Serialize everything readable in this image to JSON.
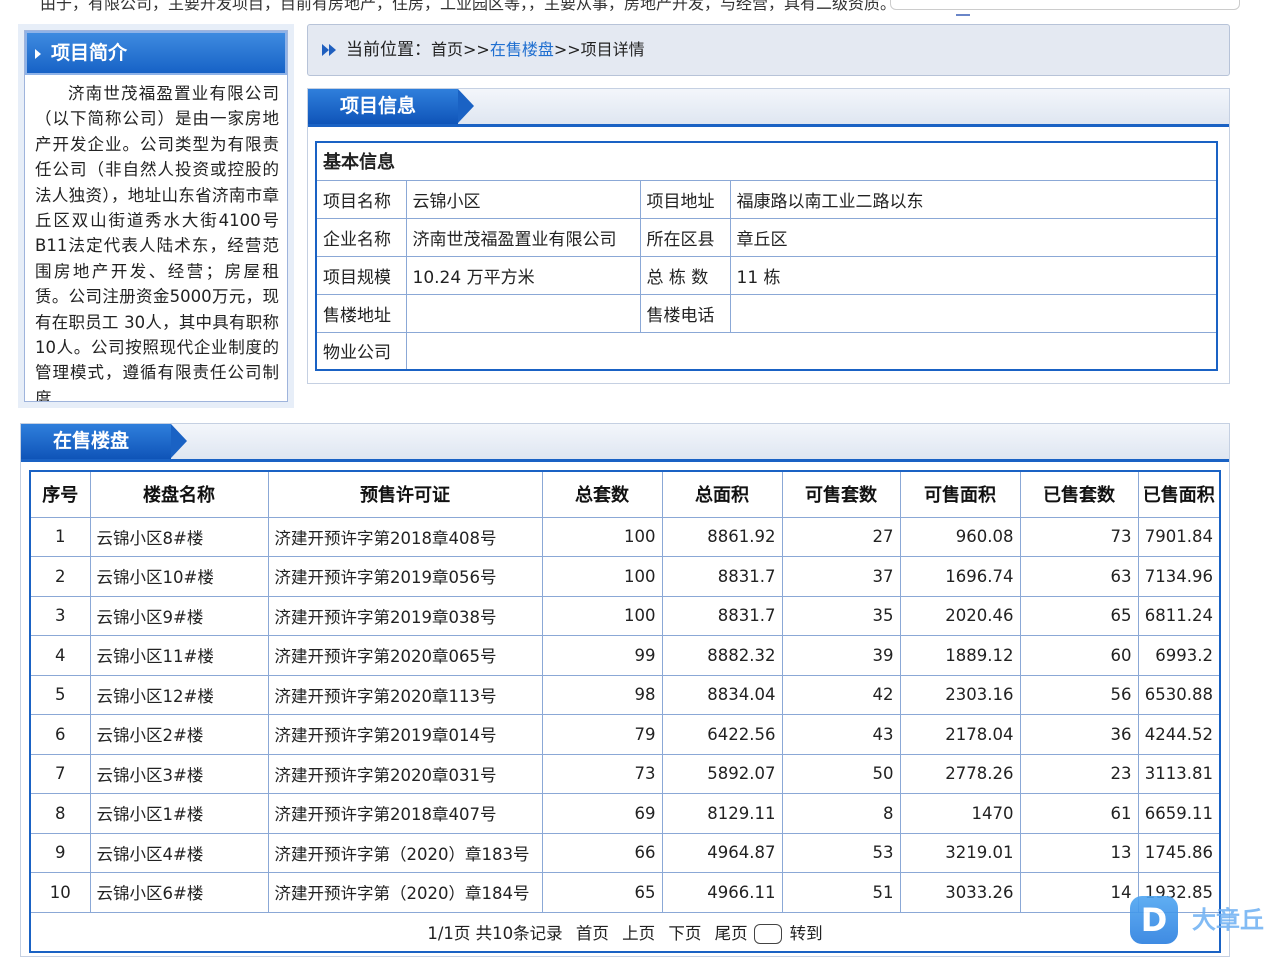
{
  "top": {
    "cut_text": "由于，有限公司，主要开发项目，目前有房地产，住房，工业园区等，，主要从事，房地产开发，与经营，具有二级资质。"
  },
  "sidebar": {
    "title": "项目简介",
    "intro": "济南世茂福盈置业有限公司（以下简称公司）是由一家房地产开发企业。公司类型为有限责任公司（非自然人投资或控股的法人独资），地址山东省济南市章丘区双山街道秀水大街4100号B11法定代表人陆术东，经营范围房地产开发、经营；房屋租赁。公司注册资金5000万元，现有在职员工 30人，其中具有职称10人。公司按照现代企业制度的管理模式，遵循有限责任公司制度"
  },
  "breadcrumb": {
    "label": "当前位置：",
    "home": "首页>>",
    "link": "在售楼盘",
    "current": ">>项目详情"
  },
  "info": {
    "tab": "项目信息",
    "basic_title": "基本信息",
    "rows": [
      {
        "k1": "项目名称",
        "v1": "云锦小区",
        "k2": "项目地址",
        "v2": "福康路以南工业二路以东"
      },
      {
        "k1": "企业名称",
        "v1": "济南世茂福盈置业有限公司",
        "k2": "所在区县",
        "v2": "章丘区"
      },
      {
        "k1": "项目规模",
        "v1": "10.24 万平方米",
        "k2": "总 栋 数",
        "v2": "11 栋"
      },
      {
        "k1": "售楼地址",
        "v1": "",
        "k2": "售楼电话",
        "v2": ""
      }
    ],
    "last_row": {
      "k1": "物业公司",
      "v1": ""
    }
  },
  "sale": {
    "tab": "在售楼盘",
    "headers": [
      "序号",
      "楼盘名称",
      "预售许可证",
      "总套数",
      "总面积",
      "可售套数",
      "可售面积",
      "已售套数",
      "已售面积"
    ],
    "rows": [
      [
        "1",
        "云锦小区8#楼",
        "济建开预许字第2018章408号",
        "100",
        "8861.92",
        "27",
        "960.08",
        "73",
        "7901.84"
      ],
      [
        "2",
        "云锦小区10#楼",
        "济建开预许字第2019章056号",
        "100",
        "8831.7",
        "37",
        "1696.74",
        "63",
        "7134.96"
      ],
      [
        "3",
        "云锦小区9#楼",
        "济建开预许字第2019章038号",
        "100",
        "8831.7",
        "35",
        "2020.46",
        "65",
        "6811.24"
      ],
      [
        "4",
        "云锦小区11#楼",
        "济建开预许字第2020章065号",
        "99",
        "8882.32",
        "39",
        "1889.12",
        "60",
        "6993.2"
      ],
      [
        "5",
        "云锦小区12#楼",
        "济建开预许字第2020章113号",
        "98",
        "8834.04",
        "42",
        "2303.16",
        "56",
        "6530.88"
      ],
      [
        "6",
        "云锦小区2#楼",
        "济建开预许字第2019章014号",
        "79",
        "6422.56",
        "43",
        "2178.04",
        "36",
        "4244.52"
      ],
      [
        "7",
        "云锦小区3#楼",
        "济建开预许字第2020章031号",
        "73",
        "5892.07",
        "50",
        "2778.26",
        "23",
        "3113.81"
      ],
      [
        "8",
        "云锦小区1#楼",
        "济建开预许字第2018章407号",
        "69",
        "8129.11",
        "8",
        "1470",
        "61",
        "6659.11"
      ],
      [
        "9",
        "云锦小区4#楼",
        "济建开预许字第（2020）章183号",
        "66",
        "4964.87",
        "53",
        "3219.01",
        "13",
        "1745.86"
      ],
      [
        "10",
        "云锦小区6#楼",
        "济建开预许字第（2020）章184号",
        "65",
        "4966.11",
        "51",
        "3033.26",
        "14",
        "1932.85"
      ]
    ],
    "pager": {
      "summary": "1/1页 共10条记录",
      "first": "首页",
      "prev": "上页",
      "next": "下页",
      "last": "尾页",
      "goto": "转到"
    }
  },
  "watermark": {
    "logo": "D",
    "text": "大章丘"
  },
  "colors": {
    "accent": "#1a62c4",
    "link": "#1f6fd0",
    "border": "#8ba8d6"
  }
}
